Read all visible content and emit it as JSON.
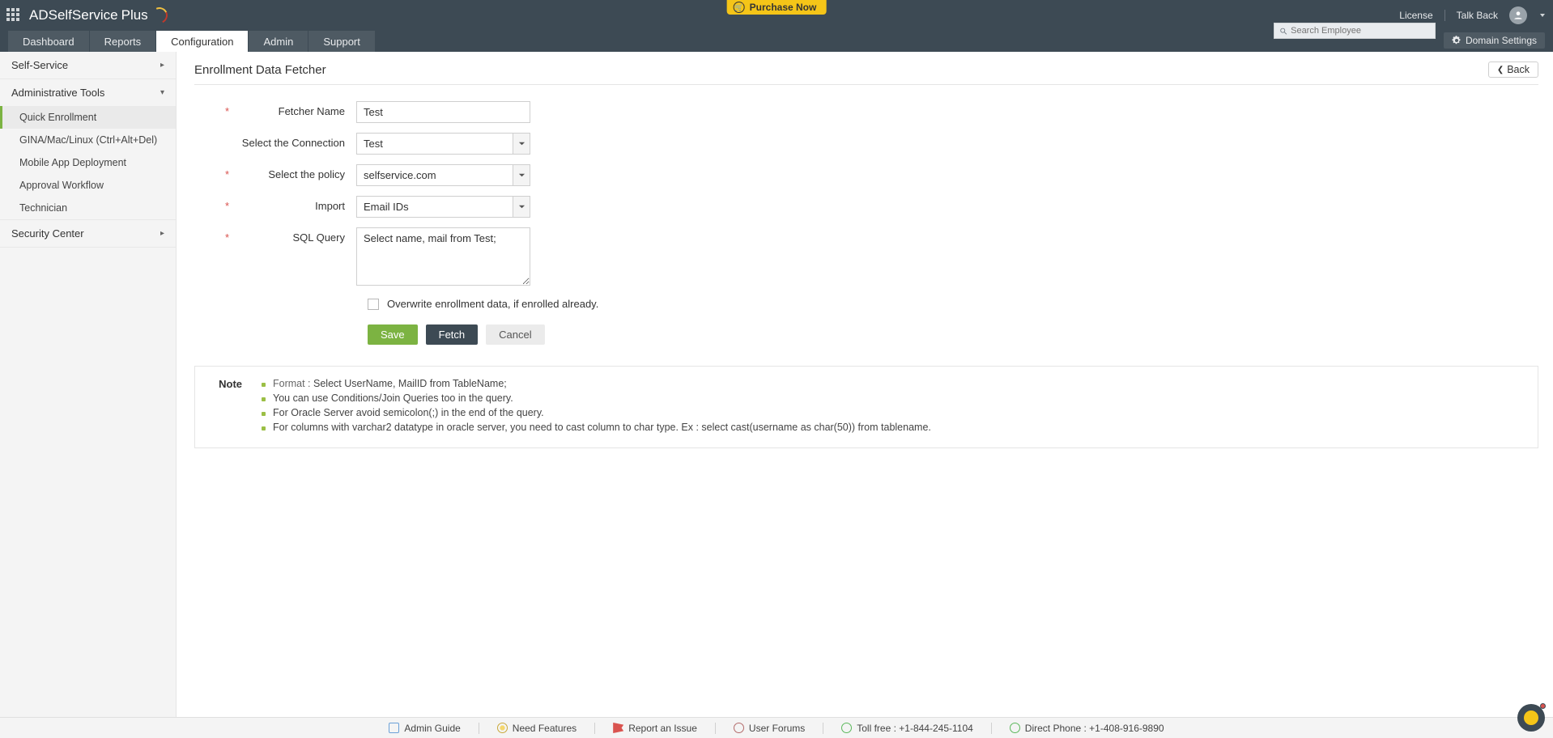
{
  "brand": {
    "name": "ADSelfService",
    "suffix": "Plus"
  },
  "purchase": {
    "label": "Purchase Now"
  },
  "top_links": {
    "license": "License",
    "talkback": "Talk Back"
  },
  "search": {
    "placeholder": "Search Employee"
  },
  "domain_settings": "Domain Settings",
  "tabs": {
    "dashboard": "Dashboard",
    "reports": "Reports",
    "configuration": "Configuration",
    "admin": "Admin",
    "support": "Support"
  },
  "sidebar": {
    "self_service": "Self-Service",
    "admin_tools": "Administrative Tools",
    "security_center": "Security Center",
    "subs": {
      "quick_enroll": "Quick Enrollment",
      "gina": "GINA/Mac/Linux (Ctrl+Alt+Del)",
      "mobile": "Mobile App Deployment",
      "approval": "Approval Workflow",
      "technician": "Technician"
    }
  },
  "page": {
    "title": "Enrollment Data Fetcher",
    "back": "Back"
  },
  "form": {
    "labels": {
      "fetcher_name": "Fetcher Name",
      "connection": "Select the Connection",
      "policy": "Select the policy",
      "import": "Import",
      "sql": "SQL Query",
      "overwrite": "Overwrite enrollment data, if enrolled already."
    },
    "values": {
      "fetcher_name": "Test",
      "connection": "Test",
      "policy": "selfservice.com",
      "import": "Email IDs",
      "sql": "Select name, mail from Test;"
    },
    "buttons": {
      "save": "Save",
      "fetch": "Fetch",
      "cancel": "Cancel"
    }
  },
  "note": {
    "label": "Note",
    "format_prefix": "Format : ",
    "format_value": "Select UserName, MailID from TableName;",
    "n2": "You can use Conditions/Join Queries too in the query.",
    "n3": "For Oracle Server avoid semicolon(;) in the end of the query.",
    "n4": "For columns with varchar2 datatype in oracle server, you need to cast column to char type. Ex : select cast(username as char(50)) from tablename."
  },
  "footer": {
    "admin_guide": "Admin Guide",
    "need_features": "Need Features",
    "report_issue": "Report an Issue",
    "user_forums": "User Forums",
    "toll_free": "Toll free : +1-844-245-1104",
    "direct": "Direct Phone : +1-408-916-9890"
  }
}
